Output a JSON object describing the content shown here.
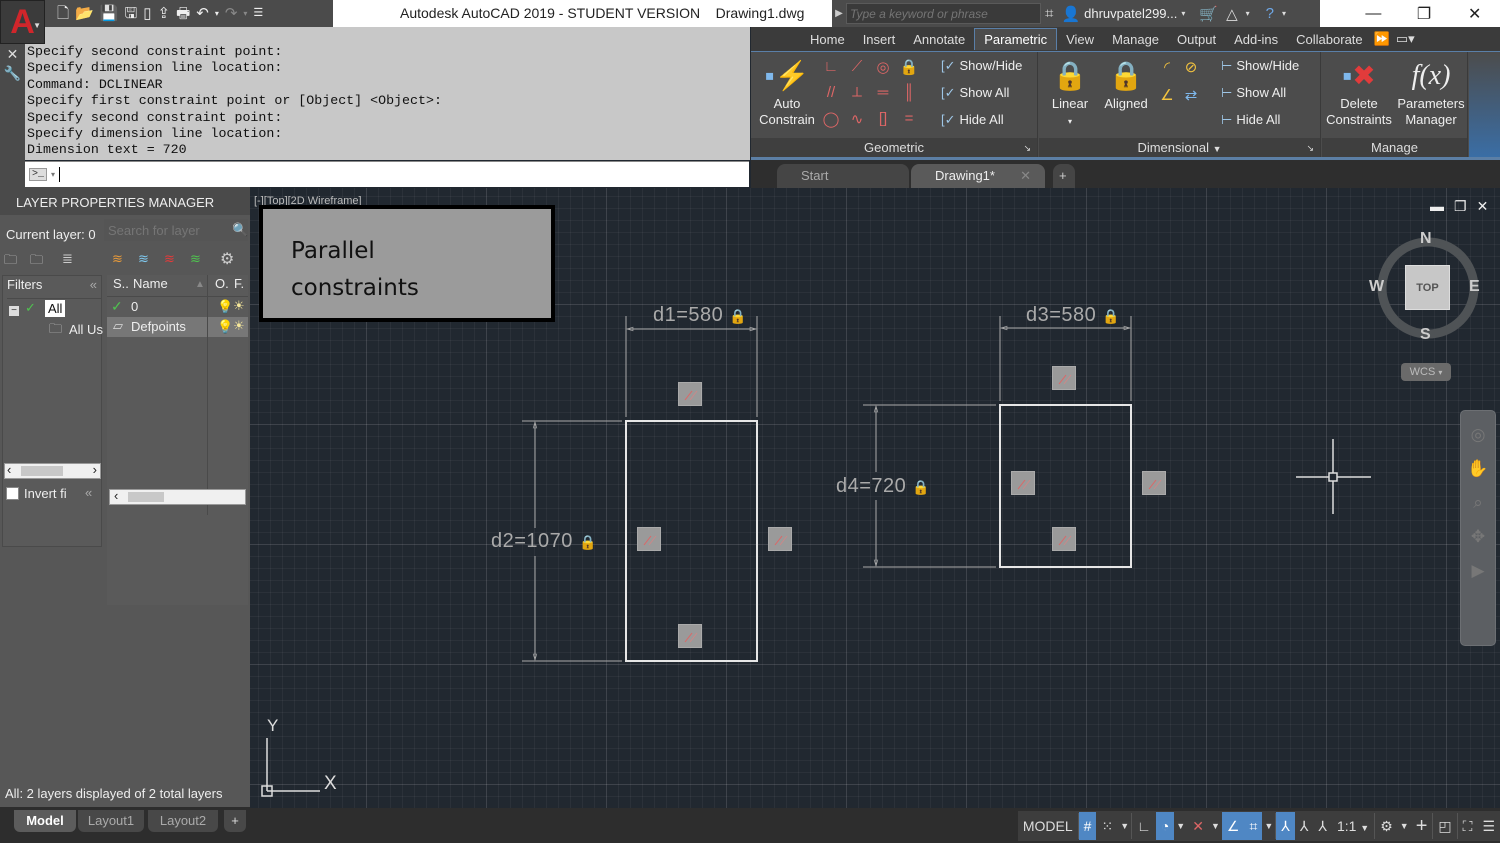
{
  "app": {
    "title": "Autodesk AutoCAD 2019 - STUDENT VERSION    Drawing1.dwg",
    "logo": "A",
    "quick_access": [
      "new-icon",
      "open-icon",
      "save-icon",
      "save-as-icon",
      "publish-icon",
      "share-icon",
      "print-icon",
      "undo-icon",
      "redo-icon",
      "customize-icon"
    ],
    "search_placeholder": "Type a keyword or phrase",
    "user": "dhruvpatel299...",
    "window_controls": {
      "minimize": "—",
      "restore": "❐",
      "close": "✕"
    }
  },
  "command_line": {
    "history": [
      "Specify second constraint point:",
      "Specify dimension line location:",
      "Command:  DCLINEAR",
      "Specify first constraint point or [Object] <Object>:",
      "Specify second constraint point:",
      "Specify dimension line location:",
      "Dimension text = 720"
    ],
    "prompt_icon": ">_",
    "input_value": ""
  },
  "ribbon": {
    "tabs": [
      "Home",
      "Insert",
      "Annotate",
      "Parametric",
      "View",
      "Manage",
      "Output",
      "Add-ins",
      "Collaborate"
    ],
    "active_tab": "Parametric",
    "panels": {
      "geometric": {
        "title": "Geometric",
        "auto_constrain": "Auto\nConstrain",
        "auto_constrain_l1": "Auto",
        "auto_constrain_l2": "Constrain",
        "show_hide": "Show/Hide",
        "show_all": "Show All",
        "hide_all": "Hide All"
      },
      "dimensional": {
        "title": "Dimensional",
        "linear": "Linear",
        "aligned": "Aligned",
        "show_hide": "Show/Hide",
        "show_all": "Show All",
        "hide_all": "Hide All"
      },
      "manage": {
        "title": "Manage",
        "delete_l1": "Delete",
        "delete_l2": "Constraints",
        "params_l1": "Parameters",
        "params_l2": "Manager"
      }
    }
  },
  "doc_tabs": [
    {
      "label": "Start",
      "active": false
    },
    {
      "label": "Drawing1*",
      "active": true
    }
  ],
  "layer_panel": {
    "title": "LAYER PROPERTIES MANAGER",
    "current_layer": "Current layer: 0",
    "search_placeholder": "Search for layer",
    "filters_label": "Filters",
    "filter_tree": [
      "All",
      "All Us"
    ],
    "columns": {
      "status": "S..",
      "name": "Name",
      "on": "O.",
      "freeze": "F."
    },
    "layers": [
      {
        "name": "0",
        "current": true
      },
      {
        "name": "Defpoints",
        "current": false
      }
    ],
    "invert_filter": "Invert fi",
    "footer": "All: 2 layers displayed of 2 total layers"
  },
  "layout_tabs": [
    {
      "label": "Model",
      "active": true
    },
    {
      "label": "Layout1",
      "active": false
    },
    {
      "label": "Layout2",
      "active": false
    }
  ],
  "viewport": {
    "label": "[-][Top][2D Wireframe]",
    "note": {
      "line1": "Parallel",
      "line2": "constraints"
    },
    "dimensions": {
      "d1": "d1=580",
      "d2": "d2=1070",
      "d3": "d3=580",
      "d4": "d4=720"
    },
    "viewcube": {
      "n": "N",
      "s": "S",
      "e": "E",
      "w": "W",
      "face": "TOP"
    },
    "wcs": "WCS",
    "ucs": {
      "x": "X",
      "y": "Y"
    }
  },
  "status_bar": {
    "model": "MODEL",
    "scale": "1:1"
  },
  "colors": {
    "accent": "#4f87c4",
    "canvas_bg": "#212830",
    "constraint_glyph": "#9a9a9a",
    "logo_red": "#d0262b"
  }
}
